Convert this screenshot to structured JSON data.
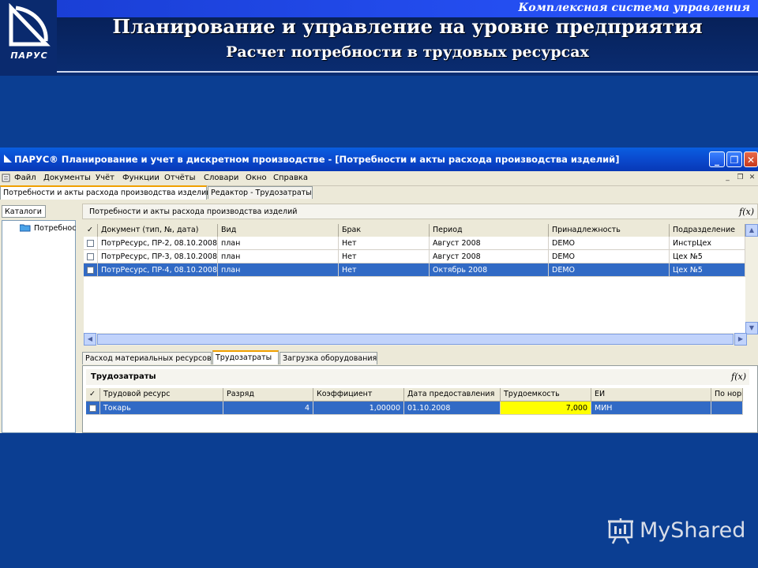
{
  "slide": {
    "top_label": "Комплексная система управления",
    "title": "Планирование и управление на уровне предприятия",
    "subtitle": "Расчет потребности в трудовых ресурсах",
    "logo_text": "ПАРУС"
  },
  "window": {
    "title": "ПАРУС® Планирование и учет в дискретном производстве - [Потребности и акты расхода производства изделий]",
    "buttons": {
      "minimize": "_",
      "maximize": "❐",
      "close": "✕"
    }
  },
  "menu": [
    "Файл",
    "Документы",
    "Учёт",
    "Функции",
    "Отчёты",
    "Словари",
    "Окно",
    "Справка"
  ],
  "doc_tabs": [
    "Потребности и акты расхода производства изделий",
    "Редактор - Трудозатраты"
  ],
  "catalog": {
    "tab": "Каталоги",
    "tree_item": "Потребнос"
  },
  "upper_grid": {
    "title": "Потребности и акты расхода производства изделий",
    "fx": "f(x)",
    "columns": [
      "✓",
      "Документ (тип, №,  дата)",
      "Вид",
      "Брак",
      "Период",
      "Принадлежность",
      "Подразделение"
    ],
    "rows": [
      [
        "",
        "ПотрРесурс, ПР-2, 08.10.2008",
        "план",
        "Нет",
        "Август 2008",
        "DEMO",
        "ИнстрЦех"
      ],
      [
        "",
        "ПотрРесурс, ПР-3, 08.10.2008",
        "план",
        "Нет",
        "Август 2008",
        "DEMO",
        "Цех №5"
      ],
      [
        "",
        "ПотрРесурс, ПР-4, 08.10.2008",
        "план",
        "Нет",
        "Октябрь 2008",
        "DEMO",
        "Цех №5"
      ]
    ],
    "selected_row": 2
  },
  "lower_tabs": [
    "Расход материальных ресурсов",
    "Трудозатраты",
    "Загрузка оборудования"
  ],
  "lower_grid": {
    "title": "Трудозатраты",
    "fx": "f(x)",
    "columns": [
      "✓",
      "Трудовой ресурс",
      "Разряд",
      "Коэффициент",
      "Дата предоставления",
      "Трудоемкость",
      "ЕИ",
      "По норм"
    ],
    "rows": [
      [
        "",
        "Токарь",
        "4",
        "1,00000",
        "01.10.2008",
        "7,000",
        "МИН",
        ""
      ]
    ]
  },
  "watermark": "MyShared",
  "colors": {
    "slide_bg": "#0b3e92",
    "selection": "#316ac5",
    "highlight": "#ffff00",
    "titlebar": "#0a4bd0"
  }
}
